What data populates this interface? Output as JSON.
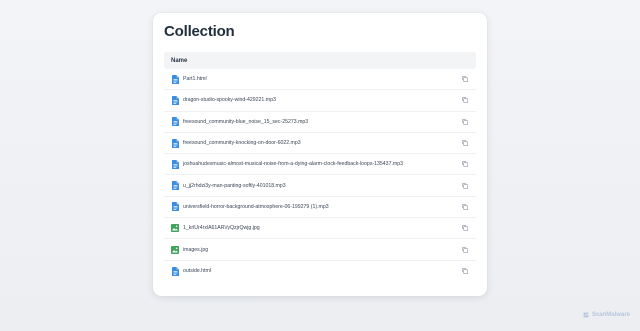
{
  "page": {
    "title": "Collection",
    "column_header": "Name"
  },
  "files": [
    {
      "name": "Part1.html",
      "icon": "document-icon",
      "color": "#3a8de0"
    },
    {
      "name": "dragon-studio-spooky-wind-429221.mp3",
      "icon": "document-icon",
      "color": "#3a8de0"
    },
    {
      "name": "freesound_community-blue_noise_15_sec-25273.mp3",
      "icon": "document-icon",
      "color": "#3a8de0"
    },
    {
      "name": "freesound_community-knocking-on-door-6022.mp3",
      "icon": "document-icon",
      "color": "#3a8de0"
    },
    {
      "name": "joshuahudesmusic-almost-musical-noise-from-a-dying-alarm-clock-feedback-loops-135437.mp3",
      "icon": "document-icon",
      "color": "#3a8de0"
    },
    {
      "name": "u_jj2rhdzi3y-man-panting-softly-401018.mp3",
      "icon": "document-icon",
      "color": "#3a8de0"
    },
    {
      "name": "universfield-horror-background-atmosphere-06-199279 (1).mp3",
      "icon": "document-icon",
      "color": "#3a8de0"
    },
    {
      "name": "1_krlUr4rxlA61AR\\/yQzjrQwjg.jpg",
      "icon": "image-icon",
      "color": "#3fa35a"
    },
    {
      "name": "images.jpg",
      "icon": "image-icon",
      "color": "#3fa35a"
    },
    {
      "name": "outside.html",
      "icon": "document-icon",
      "color": "#3a8de0"
    }
  ],
  "watermark": {
    "text": "ScanMalware"
  }
}
